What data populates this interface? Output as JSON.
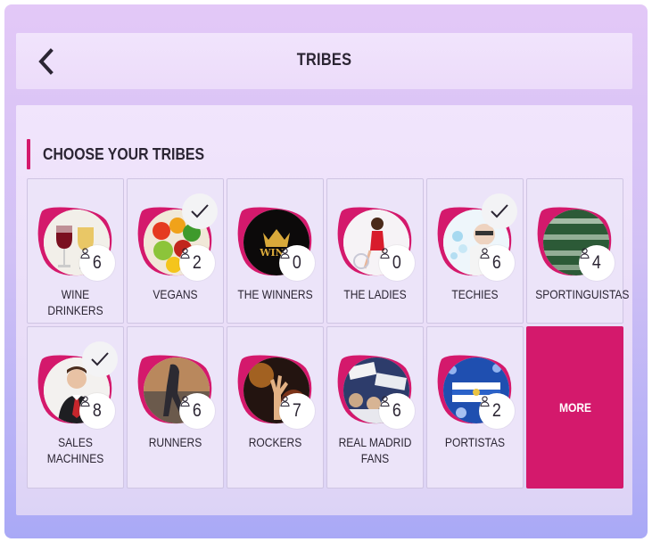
{
  "header": {
    "title": "TRIBES",
    "back_icon": "chevron-left-icon"
  },
  "section": {
    "title": "CHOOSE YOUR TRIBES",
    "accent": "#d4196c"
  },
  "colors": {
    "accent": "#d4196c",
    "card_bg": "#ece4f9",
    "text": "#2b2533"
  },
  "tribes": [
    {
      "label": "WINE DRINKERS",
      "count": "6",
      "selected": false
    },
    {
      "label": "VEGANS",
      "count": "2",
      "selected": true
    },
    {
      "label": "THE WINNERS",
      "count": "0",
      "selected": false
    },
    {
      "label": "THE LADIES",
      "count": "0",
      "selected": false
    },
    {
      "label": "TECHIES",
      "count": "6",
      "selected": true
    },
    {
      "label": "SPORTINGUISTAS",
      "count": "4",
      "selected": false
    },
    {
      "label": "SALES\nMACHINES",
      "count": "8",
      "selected": true
    },
    {
      "label": "RUNNERS",
      "count": "6",
      "selected": false
    },
    {
      "label": "ROCKERS",
      "count": "7",
      "selected": false
    },
    {
      "label": "REAL MADRID\nFANS",
      "count": "6",
      "selected": false
    },
    {
      "label": "PORTISTAS",
      "count": "2",
      "selected": false
    }
  ],
  "more": {
    "label": "MORE"
  }
}
